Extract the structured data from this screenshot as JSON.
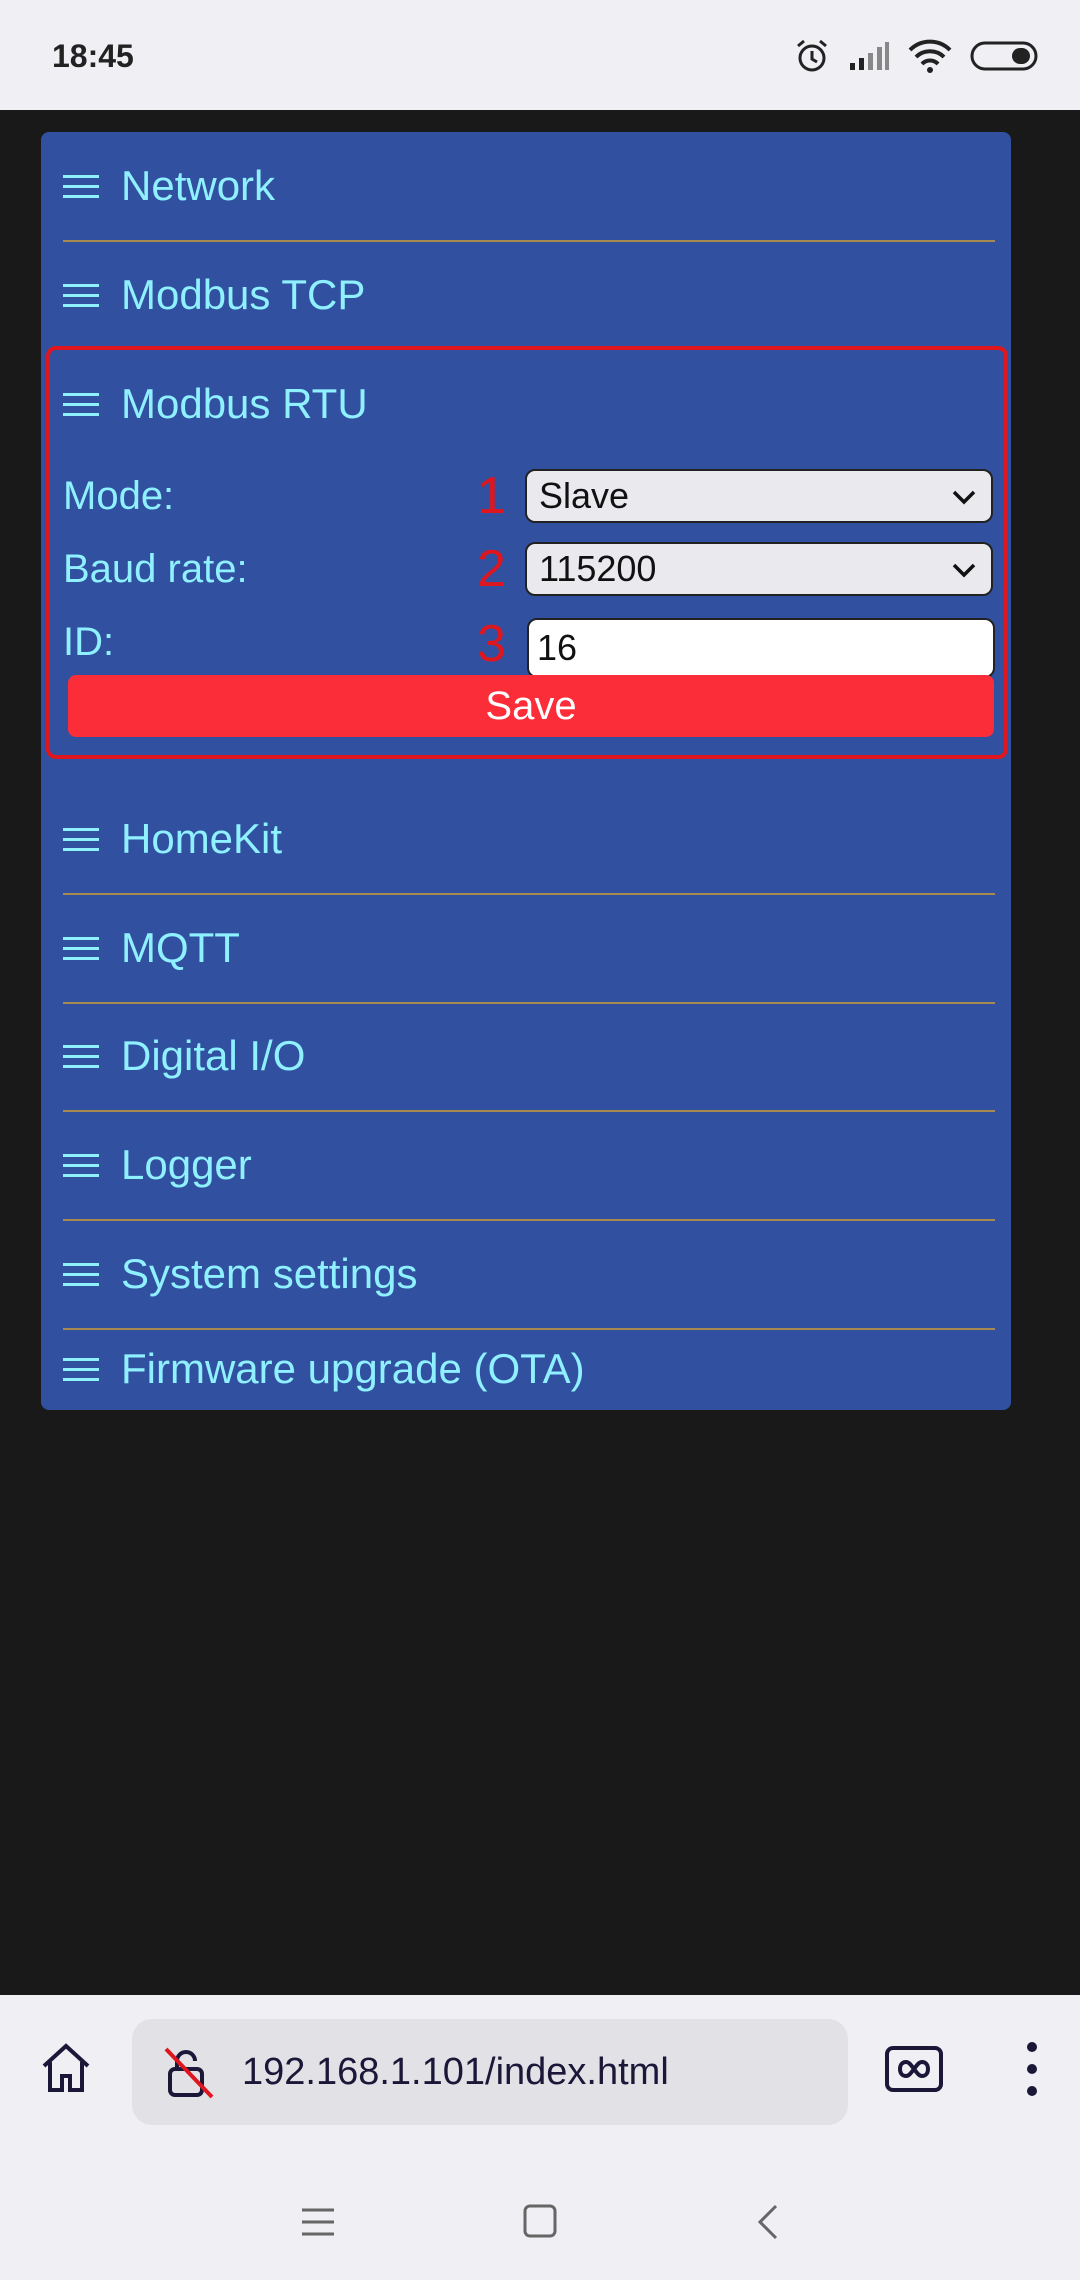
{
  "status_bar": {
    "time": "18:45",
    "icons": [
      "alarm-icon",
      "signal-icon",
      "wifi-icon",
      "battery-icon"
    ]
  },
  "menu": {
    "items": [
      {
        "label": "Network"
      },
      {
        "label": "Modbus TCP"
      },
      {
        "label": "Modbus RTU"
      },
      {
        "label": "HomeKit"
      },
      {
        "label": "MQTT"
      },
      {
        "label": "Digital I/O"
      },
      {
        "label": "Logger"
      },
      {
        "label": "System settings"
      },
      {
        "label": "Firmware upgrade (OTA)"
      }
    ]
  },
  "modbus_rtu": {
    "mode_label": "Mode:",
    "mode_value": "Slave",
    "baud_label": "Baud rate:",
    "baud_value": "115200",
    "id_label": "ID:",
    "id_value": "16",
    "save_label": "Save",
    "annotations": [
      "1",
      "2",
      "3"
    ]
  },
  "browser": {
    "url": "192.168.1.101/index.html"
  },
  "colors": {
    "panel": "#3151a0",
    "text": "#8ff0ff",
    "highlight": "#e0161e",
    "save_button": "#fb2d38"
  }
}
